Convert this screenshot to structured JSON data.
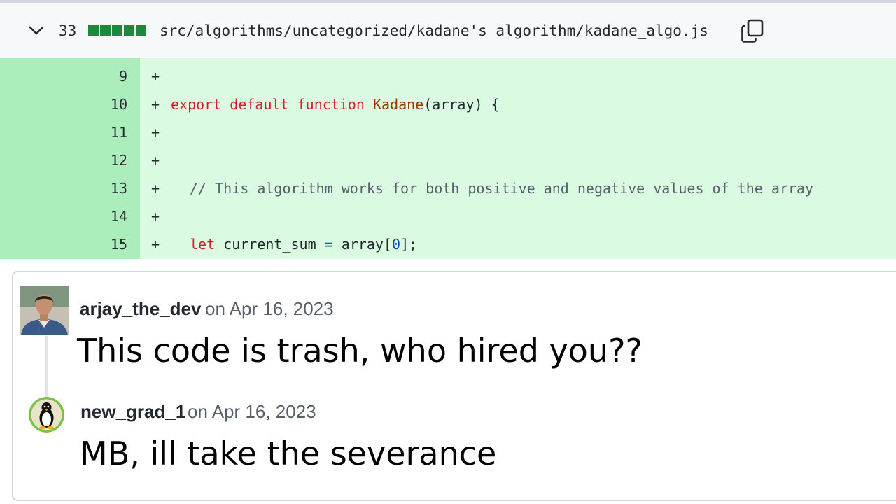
{
  "file_header": {
    "diff_count": "33",
    "path": "src/algorithms/uncategorized/kadane's algorithm/kadane_algo.js",
    "collapse_icon": "chevron-down-icon",
    "copy_icon": "copy-icon",
    "diffstat_color": "#1f883d"
  },
  "diff_lines": [
    {
      "num": "9",
      "sign": "+"
    },
    {
      "num": "10",
      "sign": "+"
    },
    {
      "num": "11",
      "sign": "+"
    },
    {
      "num": "12",
      "sign": "+"
    },
    {
      "num": "13",
      "sign": "+"
    },
    {
      "num": "14",
      "sign": "+"
    },
    {
      "num": "15",
      "sign": "+"
    }
  ],
  "code": {
    "l10_kw": "export default function",
    "l10_fn": "Kadane",
    "l10_rest": "(array) {",
    "l13_comment": "// This algorithm works for both positive and negative values of the array",
    "l15_kw": "let",
    "l15_var": "current_sum",
    "l15_op": "=",
    "l15_arr": "array[",
    "l15_num": "0",
    "l15_end": "];"
  },
  "comments": [
    {
      "author": "arjay_the_dev",
      "date": "on Apr 16, 2023",
      "body": "This code is trash, who hired you??"
    },
    {
      "author": "new_grad_1",
      "date": "on Apr 16, 2023",
      "body": "MB, ill take the severance"
    }
  ],
  "colors": {
    "added_bg": "#dafbe1",
    "added_gutter": "#aceebb",
    "keyword": "#cf222e"
  }
}
